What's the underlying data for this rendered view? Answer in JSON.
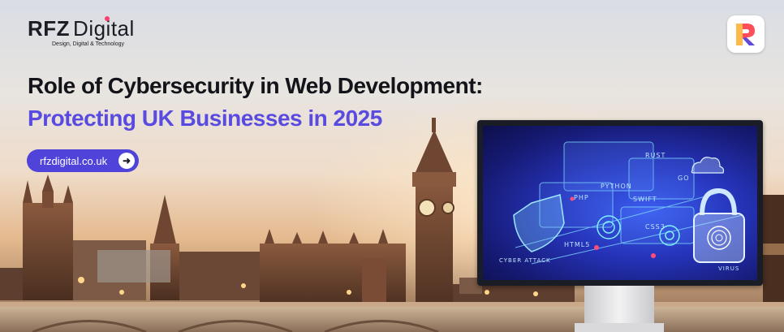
{
  "brand": {
    "name_bold": "RFZ",
    "name_light": "Digital",
    "tagline": "Design, Digital & Technology"
  },
  "headline": {
    "line1": "Role of Cybersecurity in Web Development:",
    "line2": "Protecting UK Businesses in 2025"
  },
  "cta": {
    "url_label": "rfzdigital.co.uk",
    "arrow_icon": "arrow-right-icon"
  },
  "screen_keywords": {
    "rust": "RUST",
    "go": "GO",
    "python": "PYTHON",
    "php": "PHP",
    "swift": "SWIFT",
    "html5": "HTML5",
    "css3": "CSS3",
    "cyber_attack": "CYBER ATTACK",
    "virus": "VIRUS"
  },
  "colors": {
    "accent": "#5a4be0",
    "pill": "#4f43d9",
    "screen_blue": "#2533b8",
    "logo_dot": "#ff3d6e"
  }
}
